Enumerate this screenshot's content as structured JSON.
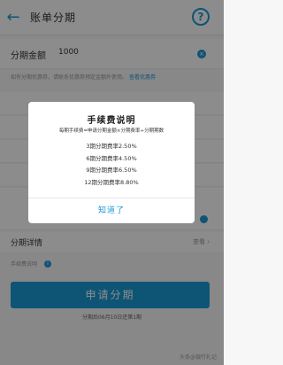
{
  "header": {
    "title": "账单分期",
    "back_icon": "back-arrow-icon",
    "help_icon": "help-icon",
    "help_glyph": "?"
  },
  "amount": {
    "label": "分期金额",
    "value": "1000"
  },
  "note": {
    "text": "如有分期优惠券，请联系优惠券预定金额外使用。",
    "link": "查看优惠券"
  },
  "detail": {
    "label": "分期详情",
    "link": "查看"
  },
  "fee": {
    "label": "手续费说明"
  },
  "apply_button": "申请分期",
  "footer": "分期后06月10日还第1期",
  "watermark": "头条@银行礼记",
  "modal": {
    "title": "手续费说明",
    "formula": "每期手续费=申请分期金额×分期费率÷分期期数",
    "rates": [
      "3期分期费率2.50%",
      "6期分期费率4.50%",
      "9期分期费率6.50%",
      "12期分期费率8.80%"
    ],
    "ok_label": "知道了"
  },
  "colors": {
    "accent": "#1b9ad6",
    "overlay": "rgba(0,0,0,0.45)"
  }
}
